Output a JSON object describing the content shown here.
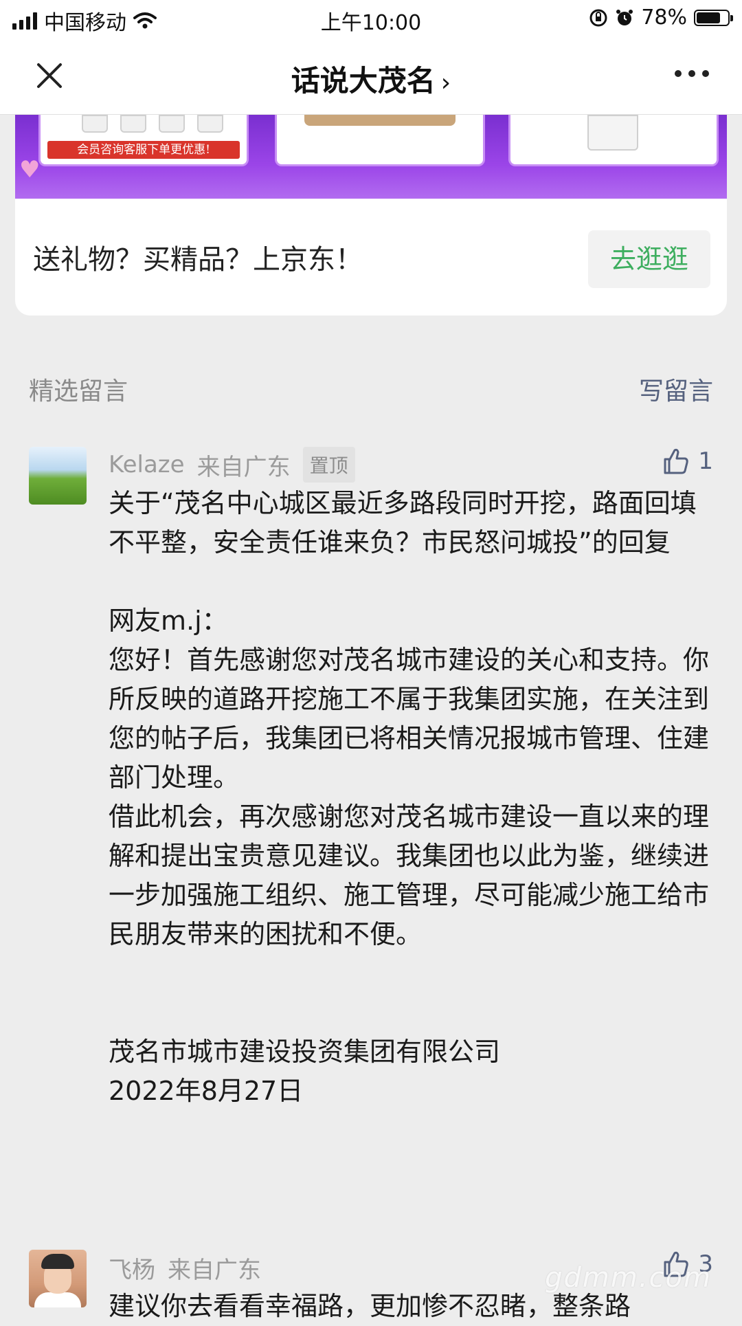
{
  "status_bar": {
    "carrier": "中国移动",
    "time": "上午10:00",
    "battery": "78%",
    "battery_level": 0.78
  },
  "nav": {
    "title": "话说大茂名",
    "title_chevron": "›",
    "close_icon": "close-icon",
    "more_icon": "more-icon"
  },
  "ad": {
    "banner_caption": "会员咨询客服下单更优惠!",
    "text": "送礼物？买精品？上京东！",
    "button": "去逛逛",
    "button_color": "#3eae5f"
  },
  "comments_section": {
    "title": "精选留言",
    "write_label": "写留言"
  },
  "comments": [
    {
      "author": "Kelaze",
      "location": "来自广东",
      "pinned_label": "置顶",
      "likes": "1",
      "content": "关于“茂名中心城区最近多路段同时开挖，路面回填不平整，安全责任谁来负？市民怒问城投”的回复\n\n网友m.j：\n您好！首先感谢您对茂名城市建设的关心和支持。你所反映的道路开挖施工不属于我集团实施，在关注到您的帖子后，我集团已将相关情况报城市管理、住建部门处理。\n借此机会，再次感谢您对茂名城市建设一直以来的理解和提出宝贵意见建议。我集团也以此为鉴，继续进一步加强施工组织、施工管理，尽可能减少施工给市民朋友带来的困扰和不便。\n\n\n茂名市城市建设投资集团有限公司\n2022年8月27日"
    },
    {
      "author": "飞杨",
      "location": "来自广东",
      "likes": "3",
      "content": "建议你去看看幸福路，更加惨不忍睹，整条路"
    }
  ],
  "watermark": "gdmm.com",
  "colors": {
    "link": "#55617e",
    "banner": "#9b45e8",
    "background": "#ededed"
  }
}
